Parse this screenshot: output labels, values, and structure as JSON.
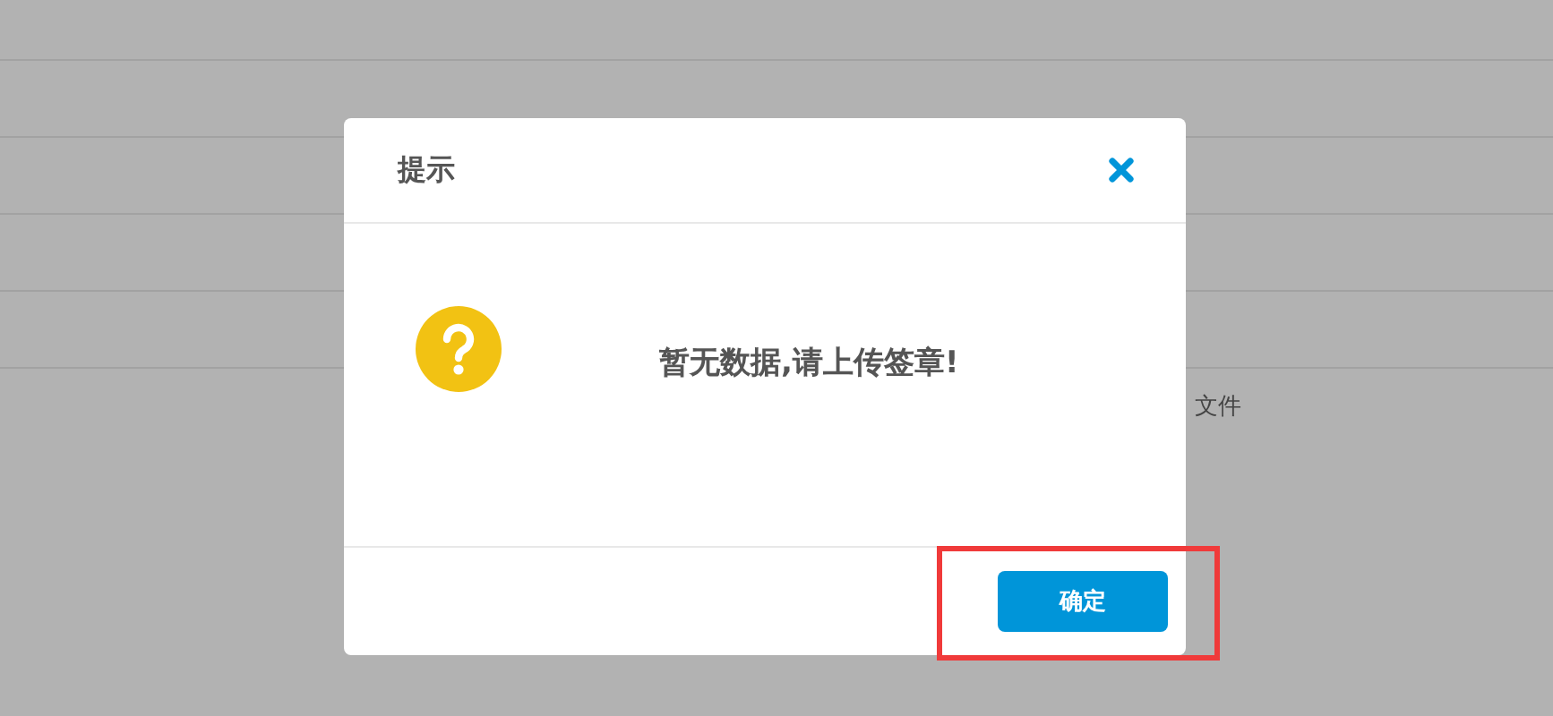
{
  "background": {
    "rows": [
      {
        "text": ""
      },
      {
        "text": ""
      },
      {
        "text": ""
      },
      {
        "text": ""
      },
      {
        "text": "文件"
      }
    ]
  },
  "dialog": {
    "title": "提示",
    "message": "暂无数据,请上传签章!",
    "confirm_button": "确定",
    "confirm_highlighted": true
  }
}
